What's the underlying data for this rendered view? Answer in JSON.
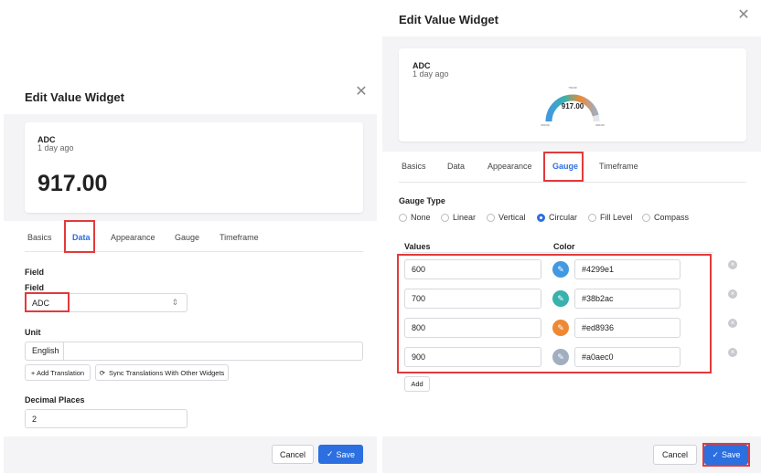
{
  "left": {
    "title": "Edit Value Widget",
    "preview": {
      "name": "ADC",
      "time": "1 day ago",
      "value": "917.00"
    },
    "tabs": [
      "Basics",
      "Data",
      "Appearance",
      "Gauge",
      "Timeframe"
    ],
    "field_section": "Field",
    "field_label": "Field",
    "field_value": "ADC",
    "unit_label": "Unit",
    "unit_lang": "English",
    "add_translation": "+ Add Translation",
    "sync_translations": "Sync Translations With Other Widgets",
    "decimal_label": "Decimal Places",
    "decimal_value": "2",
    "cancel": "Cancel",
    "save": "Save"
  },
  "right": {
    "title": "Edit Value Widget",
    "preview": {
      "name": "ADC",
      "time": "1 day ago",
      "value": "917.00",
      "gauge_top": "790.00",
      "gauge_left": "600.00",
      "gauge_right": "900.00",
      "gauge_level": 0.92
    },
    "tabs": [
      "Basics",
      "Data",
      "Appearance",
      "Gauge",
      "Timeframe"
    ],
    "gauge_type_label": "Gauge Type",
    "gauge_types": [
      "None",
      "Linear",
      "Vertical",
      "Circular",
      "Fill Level",
      "Compass"
    ],
    "selected_type": "Circular",
    "values_header": "Values",
    "color_header": "Color",
    "rows": [
      {
        "value": "600",
        "color": "#4299e1"
      },
      {
        "value": "700",
        "color": "#38b2ac"
      },
      {
        "value": "800",
        "color": "#ed8936"
      },
      {
        "value": "900",
        "color": "#a0aec0"
      }
    ],
    "add": "Add",
    "cancel": "Cancel",
    "save": "Save"
  },
  "icons": {
    "close": "close-icon",
    "eyedropper": "eyedropper-icon",
    "remove": "remove-icon",
    "chevron": "chevron-updown-icon",
    "sync": "sync-icon",
    "check": "check-icon"
  }
}
